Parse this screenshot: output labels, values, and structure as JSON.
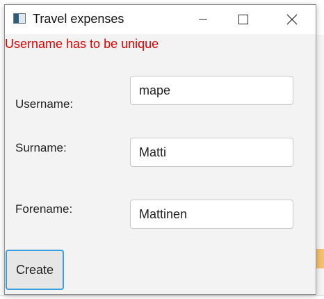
{
  "window": {
    "title": "Travel expenses"
  },
  "error_message": "Username has to be unique",
  "form": {
    "username_label": "Username:",
    "username_value": "mape",
    "surname_label": "Surname:",
    "surname_value": "Matti",
    "forename_label": "Forename:",
    "forename_value": "Mattinen"
  },
  "buttons": {
    "create_label": "Create"
  },
  "icons": {
    "app": "app-window-icon",
    "minimize": "minimize-icon",
    "maximize": "maximize-icon",
    "close": "close-icon"
  },
  "colors": {
    "error": "#e00000",
    "focus_border": "#3aa0e0",
    "window_bg": "#f3f3f3"
  }
}
